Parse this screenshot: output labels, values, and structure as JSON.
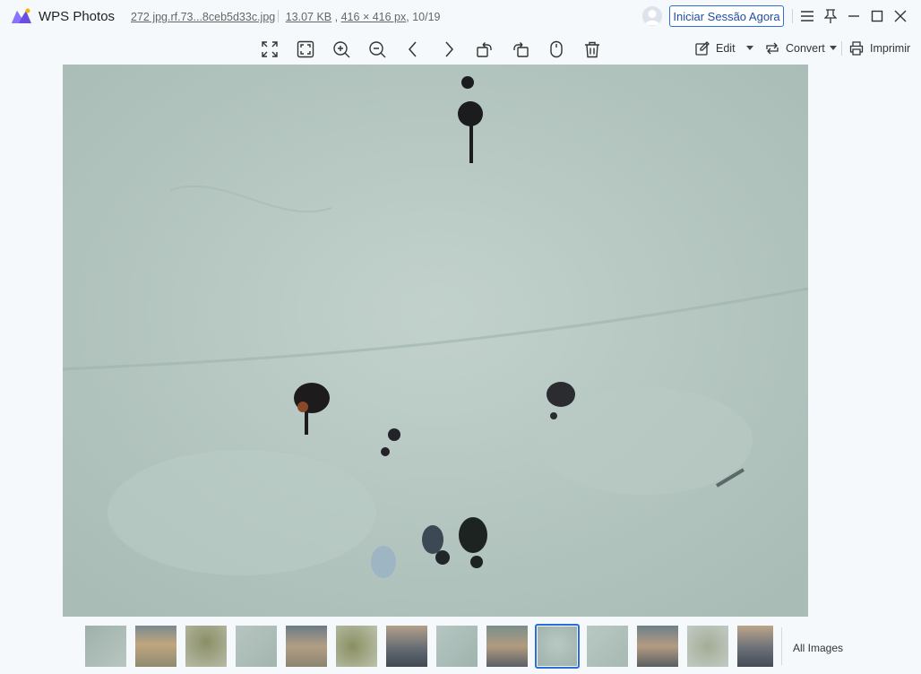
{
  "app": {
    "name": "WPS Photos"
  },
  "file": {
    "name": "272 jpg.rf.73...8ceb5d33c.jpg",
    "size": "13.07 KB",
    "dimensions": "416 × 416 px",
    "position": "10/19",
    "separator": ","
  },
  "account": {
    "login_label": "Iniciar Sessão Agora"
  },
  "toolbar": {
    "icons": [
      "fullscreen-icon",
      "fit-to-window-icon",
      "zoom-in-icon",
      "zoom-out-icon",
      "previous-icon",
      "next-icon",
      "rotate-left-icon",
      "rotate-right-icon",
      "mouse-mode-icon",
      "delete-icon"
    ],
    "edit_label": "Edit",
    "convert_label": "Convert",
    "print_label": "Imprimir"
  },
  "filmstrip": {
    "thumbnail_count": 14,
    "selected_index": 9,
    "all_images_label": "All Images"
  },
  "colors": {
    "accent": "#2b6fd6",
    "background": "#f5f9fb",
    "logo_purple": "#6b4fe0"
  }
}
